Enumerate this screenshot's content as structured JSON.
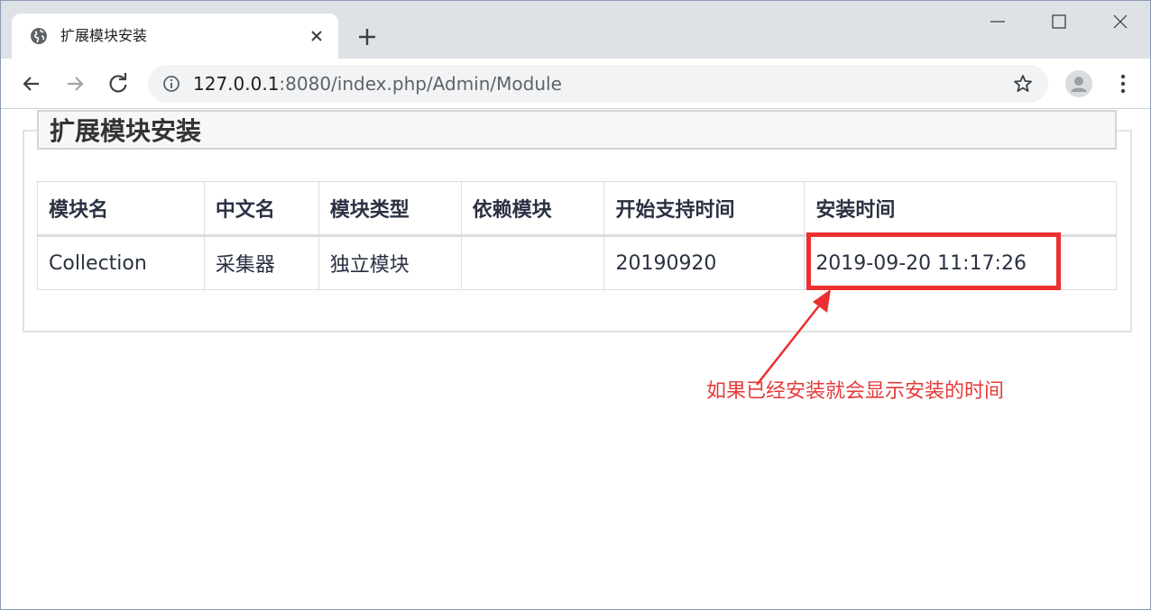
{
  "browser": {
    "tab": {
      "title": "扩展模块安装"
    },
    "url": {
      "host": "127.0.0.1",
      "rest": ":8080/index.php/Admin/Module"
    }
  },
  "page": {
    "heading": "扩展模块安装",
    "table": {
      "headers": [
        "模块名",
        "中文名",
        "模块类型",
        "依赖模块",
        "开始支持时间",
        "安装时间"
      ],
      "rows": [
        [
          "Collection",
          "采集器",
          "独立模块",
          "",
          "20190920",
          "2019-09-20 11:17:26"
        ]
      ]
    },
    "annotation": {
      "text": "如果已经安装就会显示安装的时间",
      "color": "#e63a3a"
    }
  },
  "colors": {
    "accent_red": "#ec2f2f",
    "tabstrip": "#dee1e6",
    "text": "#2a3142"
  }
}
